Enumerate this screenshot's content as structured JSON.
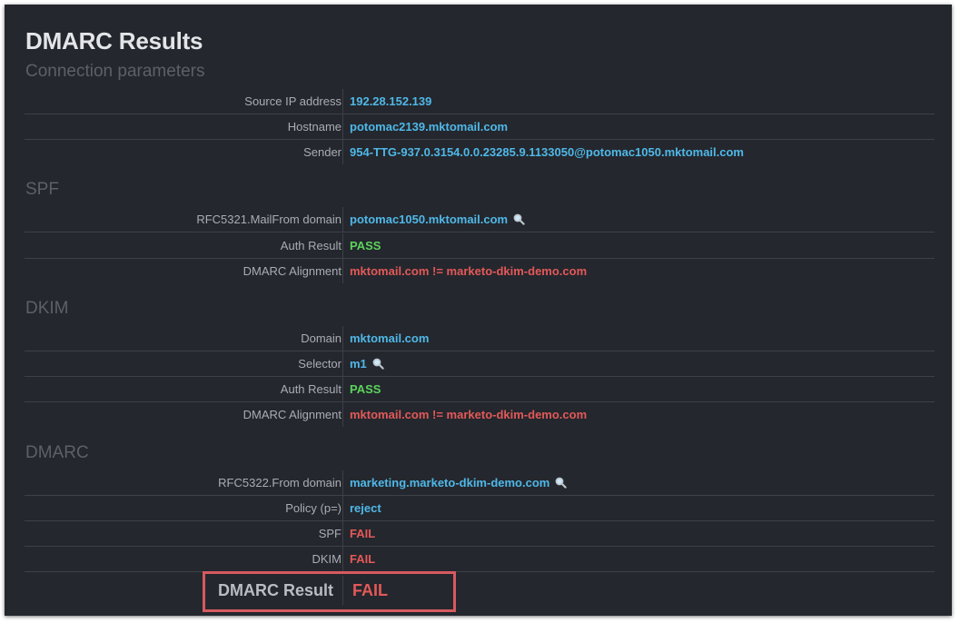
{
  "title": "DMARC Results",
  "connection": {
    "heading": "Connection parameters",
    "rows": [
      {
        "label": "Source IP address",
        "value": "192.28.152.139"
      },
      {
        "label": "Hostname",
        "value": "potomac2139.mktomail.com"
      },
      {
        "label": "Sender",
        "value": "954-TTG-937.0.3154.0.0.23285.9.1133050@potomac1050.mktomail.com"
      }
    ]
  },
  "spf": {
    "heading": "SPF",
    "rows": [
      {
        "label": "RFC5321.MailFrom domain",
        "value": "potomac1050.mktomail.com"
      },
      {
        "label": "Auth Result",
        "value": "PASS"
      },
      {
        "label": "DMARC Alignment",
        "value": "mktomail.com != marketo-dkim-demo.com"
      }
    ]
  },
  "dkim": {
    "heading": "DKIM",
    "rows": [
      {
        "label": "Domain",
        "value": "mktomail.com"
      },
      {
        "label": "Selector",
        "value": "m1"
      },
      {
        "label": "Auth Result",
        "value": "PASS"
      },
      {
        "label": "DMARC Alignment",
        "value": "mktomail.com != marketo-dkim-demo.com"
      }
    ]
  },
  "dmarc": {
    "heading": "DMARC",
    "rows": [
      {
        "label": "RFC5322.From domain",
        "value": "marketing.marketo-dkim-demo.com"
      },
      {
        "label": "Policy (p=)",
        "value": "reject"
      },
      {
        "label": "SPF",
        "value": "FAIL"
      },
      {
        "label": "DKIM",
        "value": "FAIL"
      }
    ]
  },
  "result": {
    "label": "DMARC Result",
    "value": "FAIL"
  },
  "icons": {
    "lookup": "magnifier-icon"
  },
  "colors": {
    "background": "#24272d",
    "link_blue": "#4fb8e8",
    "pass_green": "#5bd45b",
    "fail_red": "#e35959",
    "highlight": "#d75a5f"
  }
}
